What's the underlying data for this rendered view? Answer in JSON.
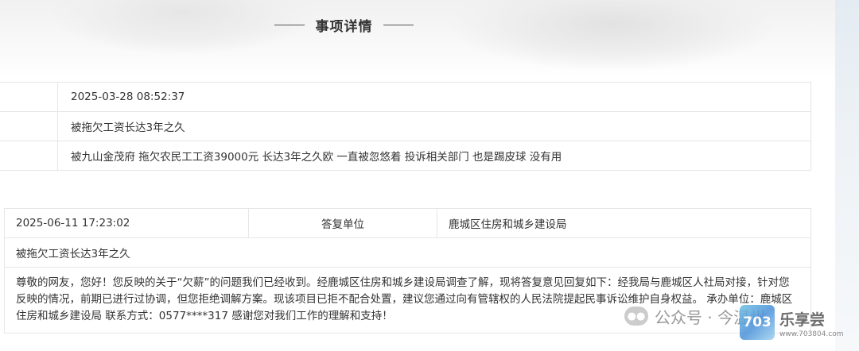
{
  "header": {
    "title": "事项详情"
  },
  "question": {
    "date": "2025-03-28 08:52:37",
    "subject": "被拖欠工资长达3年之久",
    "content": "被九山金茂府 拖欠农民工工资39000元 长达3年之久欧 一直被忽悠着 投诉相关部门 也是踢皮球 没有用"
  },
  "reply": {
    "date": "2025-06-11 17:23:02",
    "unit_label": "答复单位",
    "unit_value": "鹿城区住房和城乡建设局",
    "subject": "被拖欠工资长达3年之久",
    "content": "尊敬的网友，您好！您反映的关于“欠薪”的问题我们已经收到。经鹿城区住房和城乡建设局调查了解，现将答复意见回复如下：经我局与鹿城区人社局对接，针对您反映的情况，前期已进行过协调，但您拒绝调解方案。现该项目已拒不配合处置，建议您通过向有管辖权的人民法院提起民事诉讼维护自身权益。 承办单位：鹿城区住房和城乡建设局 联系方式：0577****317 感谢您对我们工作的理解和支持！"
  },
  "watermark": {
    "icon": "wechat-icon",
    "text": "公众号 · 今温州"
  },
  "logo": {
    "mark": "703",
    "name": "乐享尝",
    "url": "www.703804.com"
  }
}
